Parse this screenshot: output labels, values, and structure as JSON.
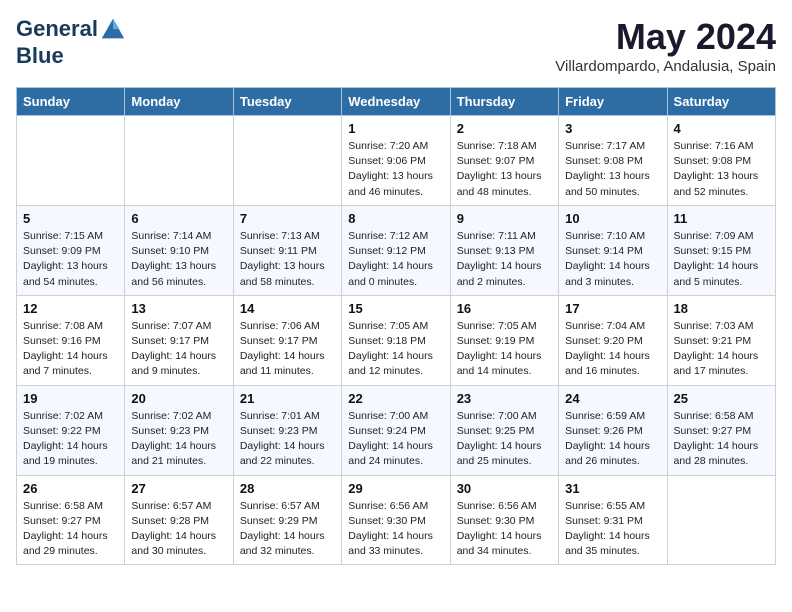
{
  "header": {
    "logo_line1": "General",
    "logo_line2": "Blue",
    "month_title": "May 2024",
    "subtitle": "Villardompardo, Andalusia, Spain"
  },
  "days_of_week": [
    "Sunday",
    "Monday",
    "Tuesday",
    "Wednesday",
    "Thursday",
    "Friday",
    "Saturday"
  ],
  "weeks": [
    [
      {
        "day": "",
        "detail": ""
      },
      {
        "day": "",
        "detail": ""
      },
      {
        "day": "",
        "detail": ""
      },
      {
        "day": "1",
        "detail": "Sunrise: 7:20 AM\nSunset: 9:06 PM\nDaylight: 13 hours\nand 46 minutes."
      },
      {
        "day": "2",
        "detail": "Sunrise: 7:18 AM\nSunset: 9:07 PM\nDaylight: 13 hours\nand 48 minutes."
      },
      {
        "day": "3",
        "detail": "Sunrise: 7:17 AM\nSunset: 9:08 PM\nDaylight: 13 hours\nand 50 minutes."
      },
      {
        "day": "4",
        "detail": "Sunrise: 7:16 AM\nSunset: 9:08 PM\nDaylight: 13 hours\nand 52 minutes."
      }
    ],
    [
      {
        "day": "5",
        "detail": "Sunrise: 7:15 AM\nSunset: 9:09 PM\nDaylight: 13 hours\nand 54 minutes."
      },
      {
        "day": "6",
        "detail": "Sunrise: 7:14 AM\nSunset: 9:10 PM\nDaylight: 13 hours\nand 56 minutes."
      },
      {
        "day": "7",
        "detail": "Sunrise: 7:13 AM\nSunset: 9:11 PM\nDaylight: 13 hours\nand 58 minutes."
      },
      {
        "day": "8",
        "detail": "Sunrise: 7:12 AM\nSunset: 9:12 PM\nDaylight: 14 hours\nand 0 minutes."
      },
      {
        "day": "9",
        "detail": "Sunrise: 7:11 AM\nSunset: 9:13 PM\nDaylight: 14 hours\nand 2 minutes."
      },
      {
        "day": "10",
        "detail": "Sunrise: 7:10 AM\nSunset: 9:14 PM\nDaylight: 14 hours\nand 3 minutes."
      },
      {
        "day": "11",
        "detail": "Sunrise: 7:09 AM\nSunset: 9:15 PM\nDaylight: 14 hours\nand 5 minutes."
      }
    ],
    [
      {
        "day": "12",
        "detail": "Sunrise: 7:08 AM\nSunset: 9:16 PM\nDaylight: 14 hours\nand 7 minutes."
      },
      {
        "day": "13",
        "detail": "Sunrise: 7:07 AM\nSunset: 9:17 PM\nDaylight: 14 hours\nand 9 minutes."
      },
      {
        "day": "14",
        "detail": "Sunrise: 7:06 AM\nSunset: 9:17 PM\nDaylight: 14 hours\nand 11 minutes."
      },
      {
        "day": "15",
        "detail": "Sunrise: 7:05 AM\nSunset: 9:18 PM\nDaylight: 14 hours\nand 12 minutes."
      },
      {
        "day": "16",
        "detail": "Sunrise: 7:05 AM\nSunset: 9:19 PM\nDaylight: 14 hours\nand 14 minutes."
      },
      {
        "day": "17",
        "detail": "Sunrise: 7:04 AM\nSunset: 9:20 PM\nDaylight: 14 hours\nand 16 minutes."
      },
      {
        "day": "18",
        "detail": "Sunrise: 7:03 AM\nSunset: 9:21 PM\nDaylight: 14 hours\nand 17 minutes."
      }
    ],
    [
      {
        "day": "19",
        "detail": "Sunrise: 7:02 AM\nSunset: 9:22 PM\nDaylight: 14 hours\nand 19 minutes."
      },
      {
        "day": "20",
        "detail": "Sunrise: 7:02 AM\nSunset: 9:23 PM\nDaylight: 14 hours\nand 21 minutes."
      },
      {
        "day": "21",
        "detail": "Sunrise: 7:01 AM\nSunset: 9:23 PM\nDaylight: 14 hours\nand 22 minutes."
      },
      {
        "day": "22",
        "detail": "Sunrise: 7:00 AM\nSunset: 9:24 PM\nDaylight: 14 hours\nand 24 minutes."
      },
      {
        "day": "23",
        "detail": "Sunrise: 7:00 AM\nSunset: 9:25 PM\nDaylight: 14 hours\nand 25 minutes."
      },
      {
        "day": "24",
        "detail": "Sunrise: 6:59 AM\nSunset: 9:26 PM\nDaylight: 14 hours\nand 26 minutes."
      },
      {
        "day": "25",
        "detail": "Sunrise: 6:58 AM\nSunset: 9:27 PM\nDaylight: 14 hours\nand 28 minutes."
      }
    ],
    [
      {
        "day": "26",
        "detail": "Sunrise: 6:58 AM\nSunset: 9:27 PM\nDaylight: 14 hours\nand 29 minutes."
      },
      {
        "day": "27",
        "detail": "Sunrise: 6:57 AM\nSunset: 9:28 PM\nDaylight: 14 hours\nand 30 minutes."
      },
      {
        "day": "28",
        "detail": "Sunrise: 6:57 AM\nSunset: 9:29 PM\nDaylight: 14 hours\nand 32 minutes."
      },
      {
        "day": "29",
        "detail": "Sunrise: 6:56 AM\nSunset: 9:30 PM\nDaylight: 14 hours\nand 33 minutes."
      },
      {
        "day": "30",
        "detail": "Sunrise: 6:56 AM\nSunset: 9:30 PM\nDaylight: 14 hours\nand 34 minutes."
      },
      {
        "day": "31",
        "detail": "Sunrise: 6:55 AM\nSunset: 9:31 PM\nDaylight: 14 hours\nand 35 minutes."
      },
      {
        "day": "",
        "detail": ""
      }
    ]
  ]
}
